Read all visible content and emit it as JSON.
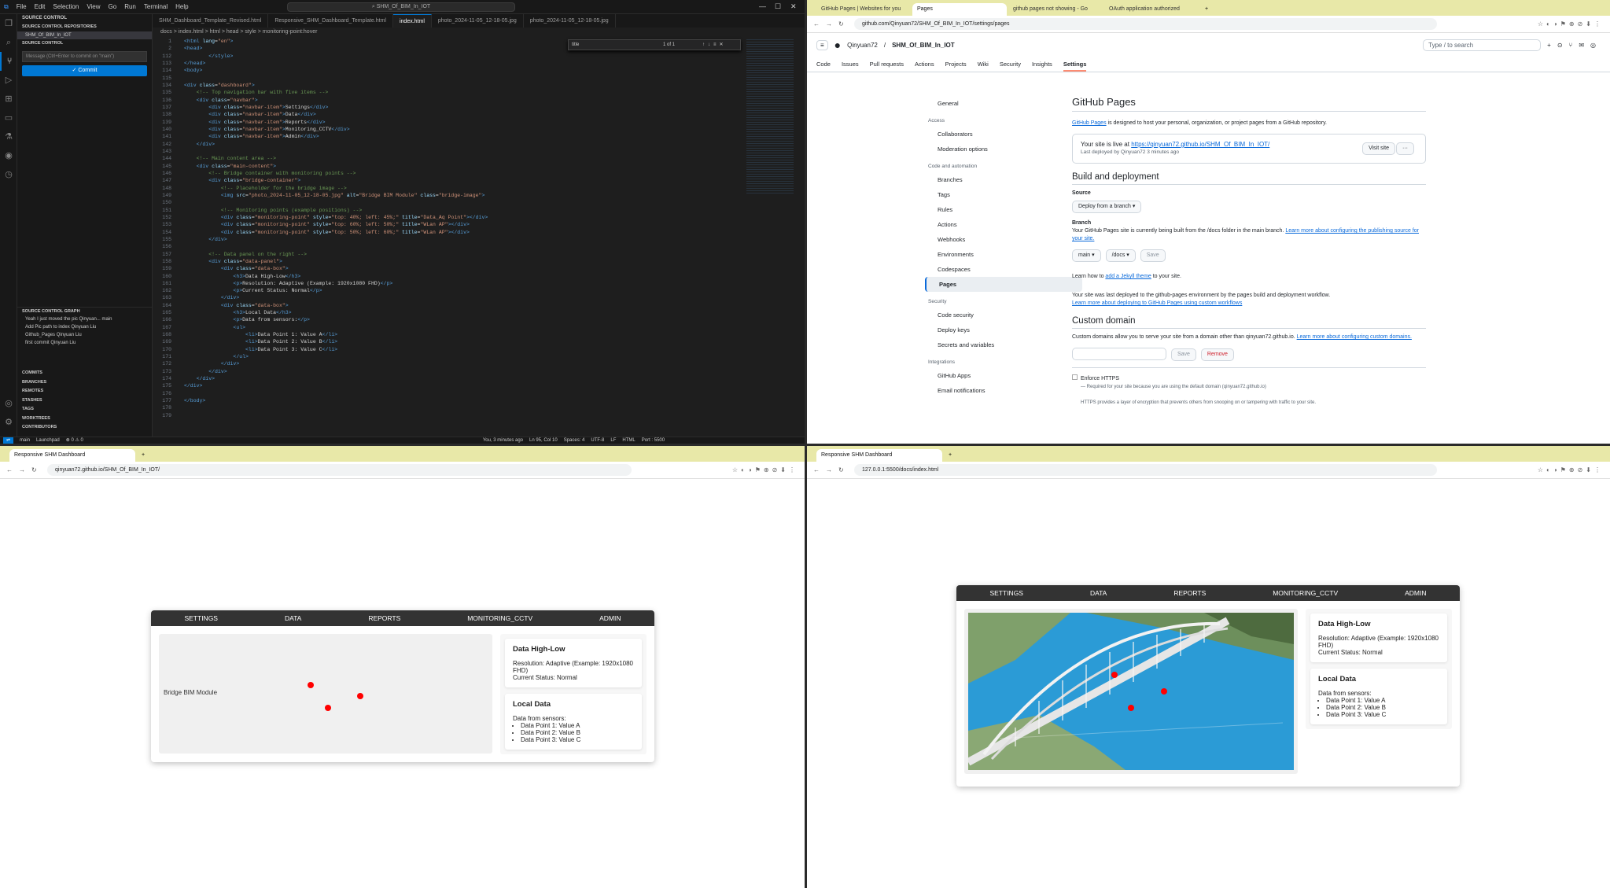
{
  "vscode": {
    "menu": [
      "File",
      "Edit",
      "Selection",
      "View",
      "Go",
      "Run",
      "Terminal",
      "Help"
    ],
    "search": "SHM_Of_BIM_In_IOT",
    "sidebar_title": "Source Control",
    "repos_header": "Source Control Repositories",
    "repo": "SHM_Of_BIM_In_IOT",
    "sc_header": "Source Control",
    "message_placeholder": "Message (Ctrl+Enter to commit on \"main\")",
    "commit_label": "✓ Commit",
    "graph_header": "Source Control Graph",
    "graph_items": [
      "Yeah I just moved the pic  Qinyuan... main",
      "Add Pic path to index  Qinyuan Liu",
      "Github_Pages  Qinyuan Liu",
      "first commit  Qinyuan Liu"
    ],
    "sections": [
      "Commits",
      "Branches",
      "Remotes",
      "Stashes",
      "Tags",
      "Worktrees",
      "Contributors"
    ],
    "tabs": [
      "SHM_Dashboard_Template_Revised.html",
      "Responsive_SHM_Dashboard_Template.html",
      "index.html",
      "photo_2024-11-05_12-18-05.jpg",
      "photo_2024-11-05_12-18-05.jpg"
    ],
    "breadcrumb": "docs > index.html > html > head > style > monitoring-point:hover",
    "find_value": "title",
    "find_count": "1 of 1",
    "status": [
      "main",
      "Launchpad",
      "⊗ 0 ⚠ 0",
      "You, 3 minutes ago",
      "Ln 95, Col 10",
      "Spaces: 4",
      "UTF-8",
      "LF",
      "HTML",
      "Port : 5500"
    ]
  },
  "gh": {
    "tabs": [
      "GitHub Pages | Websites for you",
      "Pages",
      "github pages not showing - Go",
      "OAuth application authorized"
    ],
    "url": "github.com/Qinyuan72/SHM_Of_BIM_In_IOT/settings/pages",
    "owner": "Qinyuan72",
    "repo": "SHM_Of_BIM_In_IOT",
    "search": "Type / to search",
    "nav": [
      "Code",
      "Issues",
      "Pull requests",
      "Actions",
      "Projects",
      "Wiki",
      "Security",
      "Insights",
      "Settings"
    ],
    "side": {
      "general": "General",
      "access": "Access",
      "collab": "Collaborators",
      "moderation": "Moderation options",
      "codeauto": "Code and automation",
      "branches": "Branches",
      "tags": "Tags",
      "rules": "Rules",
      "actions": "Actions",
      "webhooks": "Webhooks",
      "environments": "Environments",
      "codespaces": "Codespaces",
      "pages": "Pages",
      "security": "Security",
      "codesec": "Code security",
      "deploykeys": "Deploy keys",
      "secrets": "Secrets and variables",
      "integrations": "Integrations",
      "ghapps": "GitHub Apps",
      "email": "Email notifications"
    },
    "title": "GitHub Pages",
    "intro_link": "GitHub Pages",
    "intro": " is designed to host your personal, organization, or project pages from a GitHub repository.",
    "live_text": "Your site is live at ",
    "live_url": "https://qinyuan72.github.io/SHM_Of_BIM_In_IOT/",
    "last_deployed": "Last deployed by  Qinyuan72 3 minutes ago",
    "visit": "Visit site",
    "build_title": "Build and deployment",
    "source_label": "Source",
    "source_value": "Deploy from a branch ▾",
    "branch_label": "Branch",
    "branch_text": "Your GitHub Pages site is currently being built from the /docs folder in the main branch. ",
    "branch_link": "Learn more about configuring the publishing source for your site.",
    "branch_btn": "main ▾",
    "folder_btn": "/docs ▾",
    "save": "Save",
    "jekyll_pre": "Learn how to ",
    "jekyll_link": "add a Jekyll theme",
    "jekyll_post": " to your site.",
    "deploy_text": "Your site was last deployed to the github-pages environment by the pages build and deployment workflow.",
    "deploy_link": "Learn more about deploying to GitHub Pages using custom workflows",
    "custom_title": "Custom domain",
    "custom_text": "Custom domains allow you to serve your site from a domain other than qinyuan72.github.io. ",
    "custom_link": "Learn more about configuring custom domains.",
    "remove": "Remove",
    "https_label": "Enforce HTTPS",
    "https_note": "— Required for your site because you are using the default domain (qinyuan72.github.io)",
    "https_more": "HTTPS provides a layer of encryption that prevents others from snooping on or tampering with traffic to your site."
  },
  "live": {
    "tab": "Responsive SHM Dashboard",
    "url": "qinyuan72.github.io/SHM_Of_BIM_In_IOT/",
    "alt": "Bridge BIM Module"
  },
  "local": {
    "tab": "Responsive SHM Dashboard",
    "url": "127.0.0.1:5500/docs/index.html"
  },
  "dashboard": {
    "nav": [
      "SETTINGS",
      "DATA",
      "REPORTS",
      "MONITORING_CCTV",
      "ADMIN"
    ],
    "box1_title": "Data High-Low",
    "box1_lines": [
      "Resolution: Adaptive (Example: 1920x1080 FHD)",
      "Current Status: Normal"
    ],
    "box2_title": "Local Data",
    "box2_intro": "Data from sensors:",
    "box2_items": [
      "Data Point 1: Value A",
      "Data Point 2: Value B",
      "Data Point 3: Value C"
    ]
  },
  "colors": {
    "accent": "#0078d4",
    "navbar": "#333333",
    "point": "#ff0000",
    "chrome_tabbar": "#e8e8a8"
  }
}
